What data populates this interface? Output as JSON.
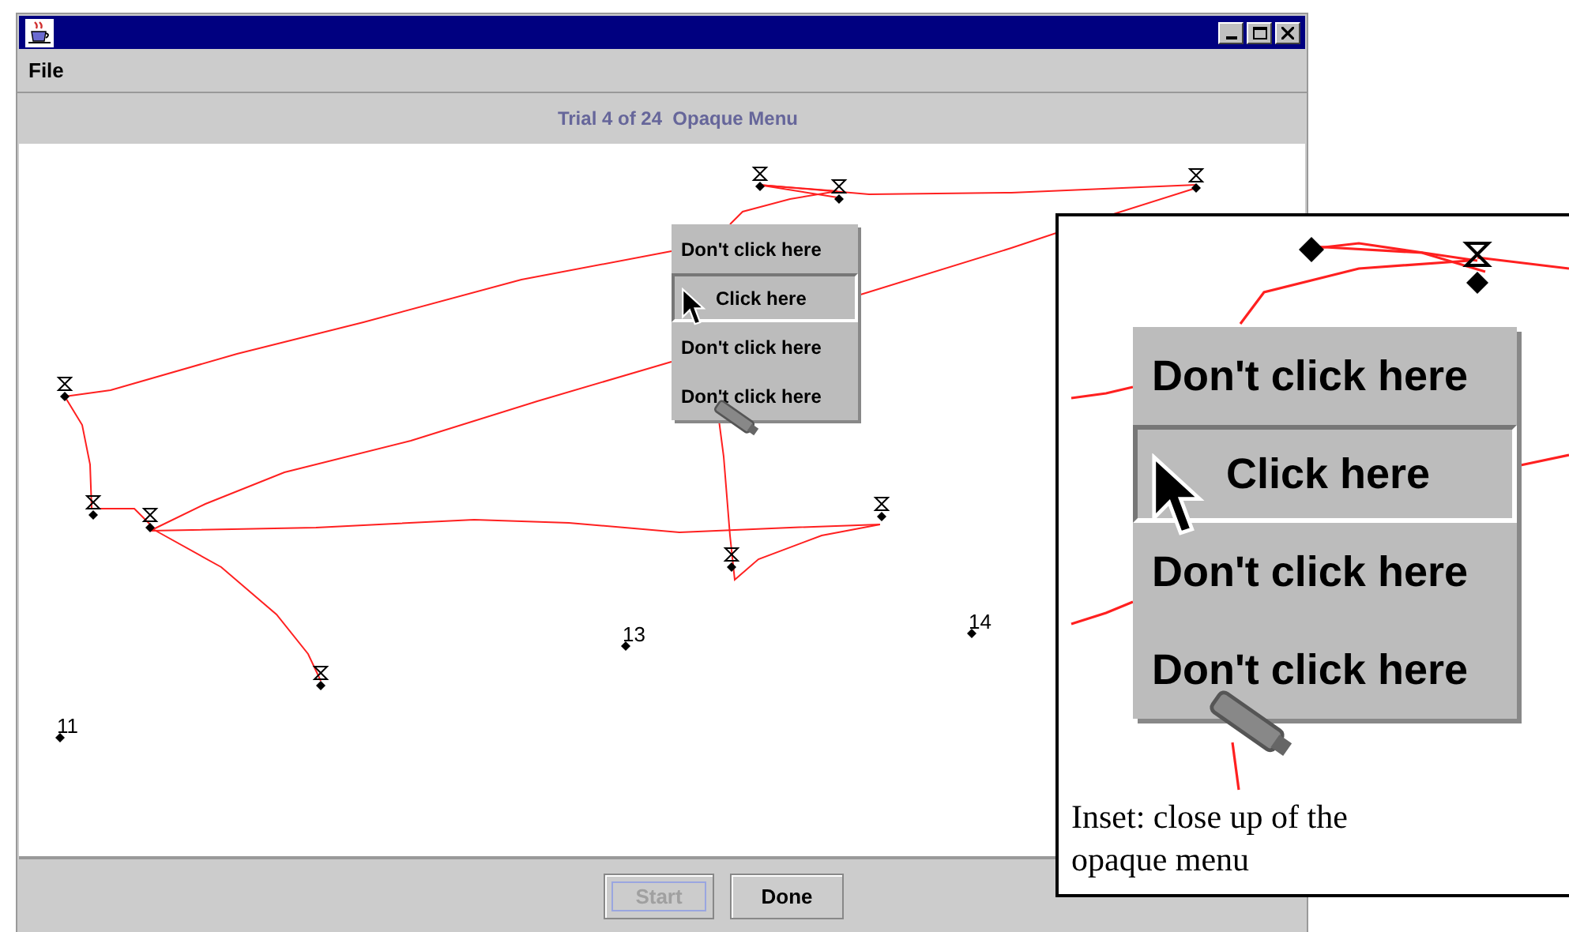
{
  "menu_bar": [
    {
      "label": "File"
    }
  ],
  "header": "Trial 4 of 24  Opaque Menu",
  "canvas": {
    "targets": [
      {
        "label": "11"
      },
      {
        "label": "13"
      },
      {
        "label": "14"
      }
    ],
    "menu": {
      "items": [
        {
          "label": "Don't click here",
          "selected": false
        },
        {
          "label": "Click here",
          "selected": true
        },
        {
          "label": "Don't click here",
          "selected": false
        },
        {
          "label": "Don't click here",
          "selected": false
        }
      ]
    }
  },
  "buttons": [
    {
      "label": "Start",
      "disabled": true
    },
    {
      "label": "Done",
      "disabled": false
    }
  ],
  "inset": {
    "menu": {
      "items": [
        {
          "label": "Don't click here",
          "selected": false
        },
        {
          "label": "Click here",
          "selected": true
        },
        {
          "label": "Don't click here",
          "selected": false
        },
        {
          "label": "Don't click here",
          "selected": false
        }
      ]
    },
    "caption": "Inset: close up of the opaque menu"
  }
}
